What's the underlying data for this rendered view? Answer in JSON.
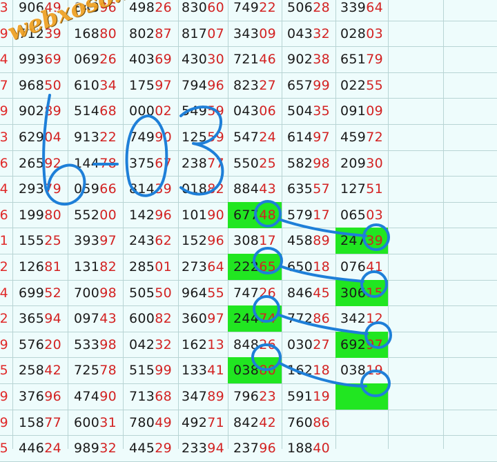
{
  "watermark": "webxoso.net",
  "handwritten_note": "6-03",
  "colors": {
    "background": "#eefcfc",
    "highlight": "#21e621",
    "ink": "#1e7fd8",
    "red_digits": "#d32222"
  },
  "rows": [
    {
      "edge": "3",
      "cells": [
        [
          "906",
          "49"
        ],
        [
          "843",
          "96"
        ],
        [
          "498",
          "26"
        ],
        [
          "830",
          "60"
        ],
        [
          "749",
          "22"
        ],
        [
          "506",
          "28"
        ],
        [
          "339",
          "64"
        ]
      ]
    },
    {
      "edge": "9",
      "cells": [
        [
          "712",
          "39"
        ],
        [
          "168",
          "80"
        ],
        [
          "802",
          "87"
        ],
        [
          "817",
          "07"
        ],
        [
          "343",
          "09"
        ],
        [
          "043",
          "32"
        ],
        [
          "028",
          "03"
        ]
      ]
    },
    {
      "edge": "4",
      "cells": [
        [
          "993",
          "69"
        ],
        [
          "069",
          "26"
        ],
        [
          "403",
          "69"
        ],
        [
          "430",
          "30"
        ],
        [
          "721",
          "46"
        ],
        [
          "902",
          "38"
        ],
        [
          "651",
          "79"
        ]
      ]
    },
    {
      "edge": "7",
      "cells": [
        [
          "968",
          "50"
        ],
        [
          "610",
          "34"
        ],
        [
          "175",
          "97"
        ],
        [
          "794",
          "96"
        ],
        [
          "823",
          "27"
        ],
        [
          "657",
          "99"
        ],
        [
          "022",
          "55"
        ]
      ]
    },
    {
      "edge": "9",
      "cells": [
        [
          "902",
          "89"
        ],
        [
          "514",
          "68"
        ],
        [
          "000",
          "02"
        ],
        [
          "549",
          "59"
        ],
        [
          "043",
          "06"
        ],
        [
          "504",
          "35"
        ],
        [
          "091",
          "09"
        ]
      ]
    },
    {
      "edge": "3",
      "cells": [
        [
          "629",
          "04"
        ],
        [
          "913",
          "22"
        ],
        [
          "749",
          "90"
        ],
        [
          "125",
          "59"
        ],
        [
          "547",
          "24"
        ],
        [
          "614",
          "97"
        ],
        [
          "459",
          "72"
        ]
      ]
    },
    {
      "edge": "6",
      "cells": [
        [
          "265",
          "92"
        ],
        [
          "144",
          "78"
        ],
        [
          "375",
          "67"
        ],
        [
          "238",
          "77"
        ],
        [
          "550",
          "25"
        ],
        [
          "582",
          "98"
        ],
        [
          "209",
          "30"
        ]
      ]
    },
    {
      "edge": "4",
      "cells": [
        [
          "293",
          "79"
        ],
        [
          "059",
          "66"
        ],
        [
          "814",
          "39"
        ],
        [
          "018",
          "82"
        ],
        [
          "884",
          "43"
        ],
        [
          "635",
          "57"
        ],
        [
          "127",
          "51"
        ]
      ]
    },
    {
      "edge": "6",
      "cells": [
        [
          "199",
          "80"
        ],
        [
          "552",
          "00"
        ],
        [
          "142",
          "96"
        ],
        [
          "101",
          "90"
        ],
        [
          "677",
          "48"
        ],
        [
          "579",
          "17"
        ],
        [
          "065",
          "03"
        ]
      ],
      "hi": [
        4
      ]
    },
    {
      "edge": "1",
      "cells": [
        [
          "155",
          "25"
        ],
        [
          "393",
          "97"
        ],
        [
          "243",
          "62"
        ],
        [
          "152",
          "96"
        ],
        [
          "308",
          "17"
        ],
        [
          "458",
          "89"
        ],
        [
          "247",
          "39"
        ]
      ],
      "hi": [
        6
      ]
    },
    {
      "edge": "2",
      "cells": [
        [
          "126",
          "81"
        ],
        [
          "131",
          "82"
        ],
        [
          "285",
          "01"
        ],
        [
          "273",
          "64"
        ],
        [
          "222",
          "65"
        ],
        [
          "650",
          "18"
        ],
        [
          "076",
          "41"
        ]
      ],
      "hi": [
        4
      ]
    },
    {
      "edge": "4",
      "cells": [
        [
          "699",
          "52"
        ],
        [
          "700",
          "98"
        ],
        [
          "505",
          "50"
        ],
        [
          "964",
          "55"
        ],
        [
          "747",
          "26"
        ],
        [
          "846",
          "45"
        ],
        [
          "306",
          "15"
        ]
      ],
      "hi": [
        6
      ]
    },
    {
      "edge": "2",
      "cells": [
        [
          "365",
          "94"
        ],
        [
          "097",
          "43"
        ],
        [
          "600",
          "82"
        ],
        [
          "360",
          "97"
        ],
        [
          "244",
          "74"
        ],
        [
          "772",
          "86"
        ],
        [
          "342",
          "12"
        ]
      ],
      "hi": [
        4
      ]
    },
    {
      "edge": "9",
      "cells": [
        [
          "576",
          "20"
        ],
        [
          "533",
          "98"
        ],
        [
          "042",
          "32"
        ],
        [
          "162",
          "13"
        ],
        [
          "848",
          "26"
        ],
        [
          "030",
          "27"
        ],
        [
          "692",
          "97"
        ]
      ],
      "hi": [
        6
      ]
    },
    {
      "edge": "5",
      "cells": [
        [
          "258",
          "42"
        ],
        [
          "725",
          "78"
        ],
        [
          "515",
          "99"
        ],
        [
          "133",
          "41"
        ],
        [
          "038",
          "80"
        ],
        [
          "162",
          "18"
        ],
        [
          "038",
          "19"
        ]
      ],
      "hi": [
        4
      ]
    },
    {
      "edge": "9",
      "cells": [
        [
          "376",
          "96"
        ],
        [
          "474",
          "90"
        ],
        [
          "713",
          "68"
        ],
        [
          "347",
          "89"
        ],
        [
          "796",
          "23"
        ],
        [
          "591",
          "19"
        ],
        [
          "",
          ""
        ]
      ],
      "hi": [
        6
      ]
    },
    {
      "edge": "9",
      "cells": [
        [
          "158",
          "77"
        ],
        [
          "600",
          "31"
        ],
        [
          "780",
          "49"
        ],
        [
          "492",
          "71"
        ],
        [
          "842",
          "42"
        ],
        [
          "760",
          "86"
        ],
        [
          "",
          ""
        ]
      ]
    },
    {
      "edge": "5",
      "cells": [
        [
          "446",
          "24"
        ],
        [
          "989",
          "32"
        ],
        [
          "445",
          "29"
        ],
        [
          "233",
          "94"
        ],
        [
          "237",
          "96"
        ],
        [
          "188",
          "40"
        ],
        [
          "",
          ""
        ]
      ]
    }
  ]
}
